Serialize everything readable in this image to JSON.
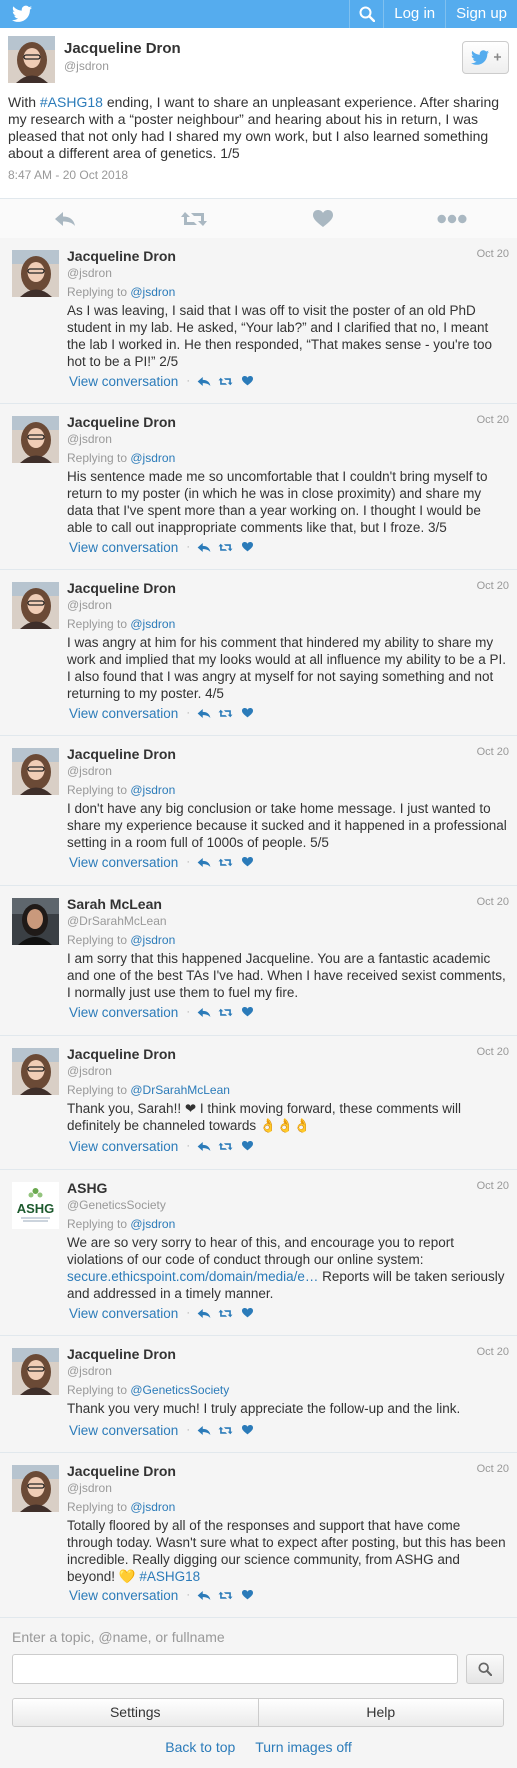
{
  "colors": {
    "brand": "#55acee",
    "link": "#2b7bb9",
    "muted": "#999999"
  },
  "topbar": {
    "logo_icon": "twitter-bird-icon",
    "search_icon": "search-icon",
    "login_label": "Log in",
    "signup_label": "Sign up"
  },
  "main_tweet": {
    "name": "Jacqueline Dron",
    "handle": "@jsdron",
    "text_before": "With ",
    "hashtag": "#ASHG18",
    "text_after": " ending, I want to share an unpleasant experience. After sharing my research with a “poster neighbour” and hearing about his in return, I was pleased that not only had I shared my own work, but I also learned something about a different area of genetics. 1/5",
    "timestamp": "8:47 AM - 20 Oct 2018"
  },
  "view_conversation_label": "View conversation",
  "replying_to_label": "Replying to ",
  "replies": [
    {
      "name": "Jacqueline Dron",
      "handle": "@jsdron",
      "date": "Oct 20",
      "replying_to": "@jsdron",
      "text": "As I was leaving, I said that I was off to visit the poster of an old PhD student in my lab. He asked, “Your lab?” and I clarified that no, I meant the lab I worked in. He then responded, “That makes sense - you're too hot to be a PI!” 2/5"
    },
    {
      "name": "Jacqueline Dron",
      "handle": "@jsdron",
      "date": "Oct 20",
      "replying_to": "@jsdron",
      "text": "His sentence made me so uncomfortable that I couldn't bring myself to return to my poster (in which he was in close proximity) and share my data that I've spent more than a year working on. I thought I would be able to call out inappropriate comments like that, but I froze. 3/5"
    },
    {
      "name": "Jacqueline Dron",
      "handle": "@jsdron",
      "date": "Oct 20",
      "replying_to": "@jsdron",
      "text": "I was angry at him for his comment that hindered my ability to share my work and implied that my looks would at all influence my ability to be a PI. I also found that I was angry at myself for not saying something and not returning to my poster. 4/5"
    },
    {
      "name": "Jacqueline Dron",
      "handle": "@jsdron",
      "date": "Oct 20",
      "replying_to": "@jsdron",
      "text": "I don't have any big conclusion or take home message. I just wanted to share my experience because it sucked and it happened in a professional setting in a room full of 1000s of people. 5/5"
    },
    {
      "name": "Sarah McLean",
      "handle": "@DrSarahMcLean",
      "date": "Oct 20",
      "replying_to": "@jsdron",
      "text": "I am sorry that this happened Jacqueline. You are a fantastic academic and one of the best TAs I've had. When I have received sexist comments, I normally just use them to fuel my fire."
    },
    {
      "name": "Jacqueline Dron",
      "handle": "@jsdron",
      "date": "Oct 20",
      "replying_to": "@DrSarahMcLean",
      "text": "Thank you, Sarah!! ❤ I think moving forward, these comments will definitely be channeled towards 👌👌👌"
    },
    {
      "name": "ASHG",
      "handle": "@GeneticsSociety",
      "date": "Oct 20",
      "replying_to": "@jsdron",
      "text": "We are so very sorry to hear of this, and encourage you to report violations of our code of conduct through our online system:",
      "link": "secure.ethicspoint.com/domain/media/e…",
      "text_after": " Reports will be taken seriously and addressed in a timely manner.",
      "avatar_text": "ASHG"
    },
    {
      "name": "Jacqueline Dron",
      "handle": "@jsdron",
      "date": "Oct 20",
      "replying_to": "@GeneticsSociety",
      "text": "Thank you very much! I truly appreciate the follow-up and the link."
    },
    {
      "name": "Jacqueline Dron",
      "handle": "@jsdron",
      "date": "Oct 20",
      "replying_to": "@jsdron",
      "text": "Totally floored by all of the responses and support that have come through today. Wasn't sure what to expect after posting, but this has been incredible. Really digging our science community, from ASHG and beyond! 💛 ",
      "hashtag": "#ASHG18"
    }
  ],
  "bottom": {
    "search_hint": "Enter a topic, @name, or fullname",
    "settings_label": "Settings",
    "help_label": "Help",
    "back_to_top_label": "Back to top",
    "images_off_label": "Turn images off"
  }
}
